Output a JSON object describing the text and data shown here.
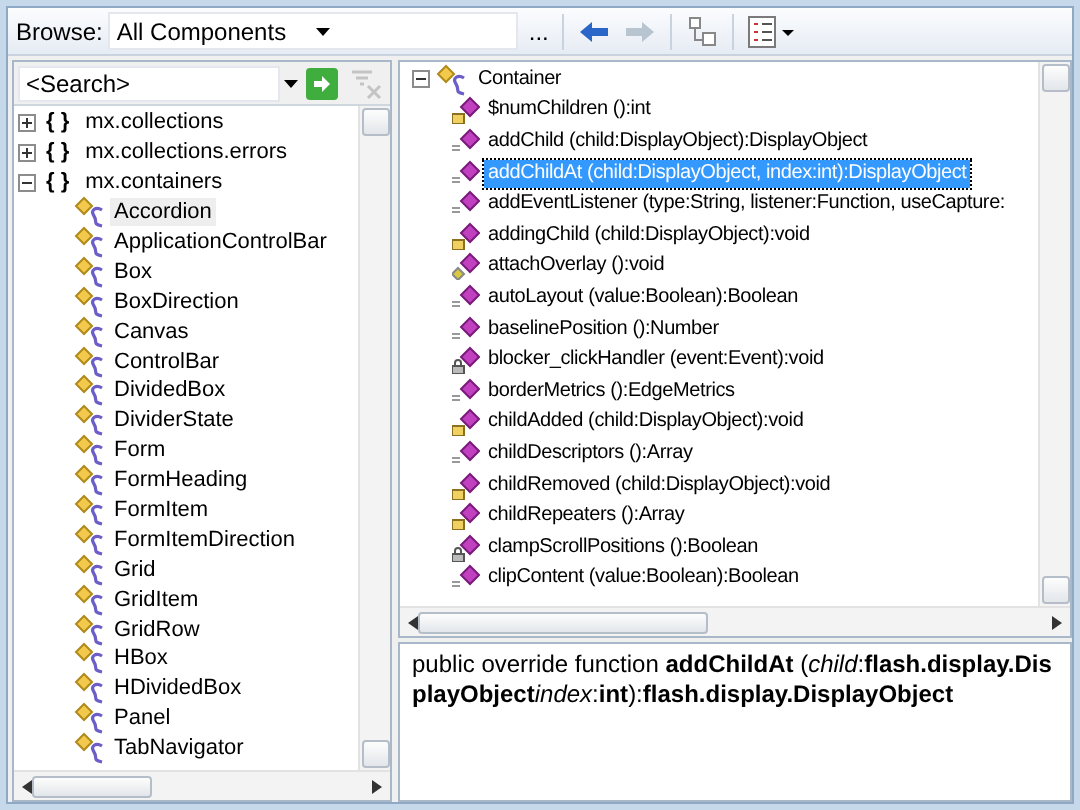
{
  "toolbar": {
    "browse_label": "Browse:",
    "browse_value": "All Components",
    "more_button": "...",
    "back": {
      "disabled": false
    },
    "forward": {
      "disabled": true
    }
  },
  "search": {
    "placeholder": "<Search>",
    "clear_disabled": true
  },
  "package_tree": [
    {
      "glyph": "{ }",
      "label": "mx.collections",
      "expanded": false
    },
    {
      "glyph": "{ }",
      "label": "mx.collections.errors",
      "expanded": false
    },
    {
      "glyph": "{ }",
      "label": "mx.containers",
      "expanded": true,
      "children": [
        {
          "label": "Accordion",
          "selected": true
        },
        {
          "label": "ApplicationControlBar",
          "selected": false
        },
        {
          "label": "Box",
          "selected": false
        },
        {
          "label": "BoxDirection",
          "selected": false
        },
        {
          "label": "Canvas",
          "selected": false
        },
        {
          "label": "ControlBar",
          "selected": false
        },
        {
          "label": "DividedBox",
          "selected": false
        },
        {
          "label": "DividerState",
          "selected": false
        },
        {
          "label": "Form",
          "selected": false
        },
        {
          "label": "FormHeading",
          "selected": false
        },
        {
          "label": "FormItem",
          "selected": false
        },
        {
          "label": "FormItemDirection",
          "selected": false
        },
        {
          "label": "Grid",
          "selected": false
        },
        {
          "label": "GridItem",
          "selected": false
        },
        {
          "label": "GridRow",
          "selected": false
        },
        {
          "label": "HBox",
          "selected": false
        },
        {
          "label": "HDividedBox",
          "selected": false
        },
        {
          "label": "Panel",
          "selected": false
        },
        {
          "label": "TabNavigator",
          "selected": false
        }
      ]
    }
  ],
  "member_tree": {
    "label": "Container",
    "expanded": true,
    "children": [
      {
        "label": "$numChildren ():int",
        "kind": "protected",
        "selected": false
      },
      {
        "label": "addChild (child:DisplayObject):DisplayObject",
        "kind": "public",
        "selected": false
      },
      {
        "label": "addChildAt (child:DisplayObject, index:int):DisplayObject",
        "kind": "public",
        "selected": true
      },
      {
        "label": "addEventListener (type:String, listener:Function, useCapture:",
        "kind": "public",
        "selected": false
      },
      {
        "label": "addingChild (child:DisplayObject):void",
        "kind": "protected",
        "selected": false
      },
      {
        "label": "attachOverlay ():void",
        "kind": "internal",
        "selected": false
      },
      {
        "label": "autoLayout (value:Boolean):Boolean",
        "kind": "public",
        "selected": false
      },
      {
        "label": "baselinePosition ():Number",
        "kind": "public",
        "selected": false
      },
      {
        "label": "blocker_clickHandler (event:Event):void",
        "kind": "private",
        "selected": false
      },
      {
        "label": "borderMetrics ():EdgeMetrics",
        "kind": "public",
        "selected": false
      },
      {
        "label": "childAdded (child:DisplayObject):void",
        "kind": "protected",
        "selected": false
      },
      {
        "label": "childDescriptors ():Array",
        "kind": "public",
        "selected": false
      },
      {
        "label": "childRemoved (child:DisplayObject):void",
        "kind": "protected",
        "selected": false
      },
      {
        "label": "childRepeaters ():Array",
        "kind": "protected",
        "selected": false
      },
      {
        "label": "clampScrollPositions ():Boolean",
        "kind": "private",
        "selected": false
      },
      {
        "label": "clipContent (value:Boolean):Boolean",
        "kind": "public",
        "selected": false
      }
    ]
  },
  "description": [
    "public override function **addChildAt** (*child*:**flash.display.DisplayObject**",
    "*index*:**int**):**flash.display.DisplayObject**"
  ]
}
